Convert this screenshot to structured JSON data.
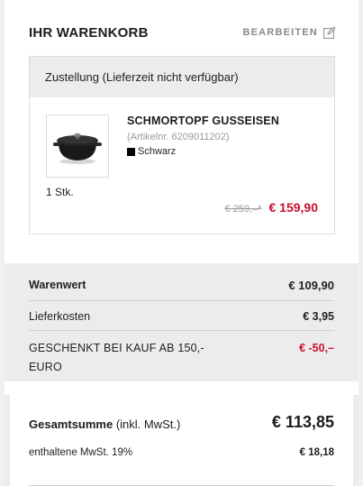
{
  "cart": {
    "title": "IHR WARENKORB",
    "edit_label": "BEARBEITEN",
    "edit_icon": "pencil-square-icon"
  },
  "delivery": {
    "heading": "Zustellung (Lieferzeit nicht verfügbar)"
  },
  "product": {
    "name": "SCHMORTOPF GUSSEISEN",
    "article_number": "(Artikelnr. 6209011202)",
    "color": "Schwarz",
    "color_swatch": "#000000",
    "quantity": "1 Stk.",
    "old_price": "€ 259,–*",
    "new_price": "€ 159,90",
    "image": "cast-iron-pot-image"
  },
  "summary": {
    "warenwert_label": "Warenwert",
    "warenwert_value": "€ 109,90",
    "lieferkosten_label": "Lieferkosten",
    "lieferkosten_value": "€ 3,95",
    "gift_label": "GESCHENKT BEI KAUF AB 150,- EURO",
    "gift_value": "€ -50,–"
  },
  "totals": {
    "total_label_bold": "Gesamtsumme",
    "total_label_suffix": " (inkl. MwSt.)",
    "total_value": "€ 113,85",
    "vat_label": "enthaltene MwSt. 19%",
    "vat_value": "€ 18,18"
  },
  "colors": {
    "accent_red": "#c8102e",
    "panel_gray": "#ececec"
  }
}
